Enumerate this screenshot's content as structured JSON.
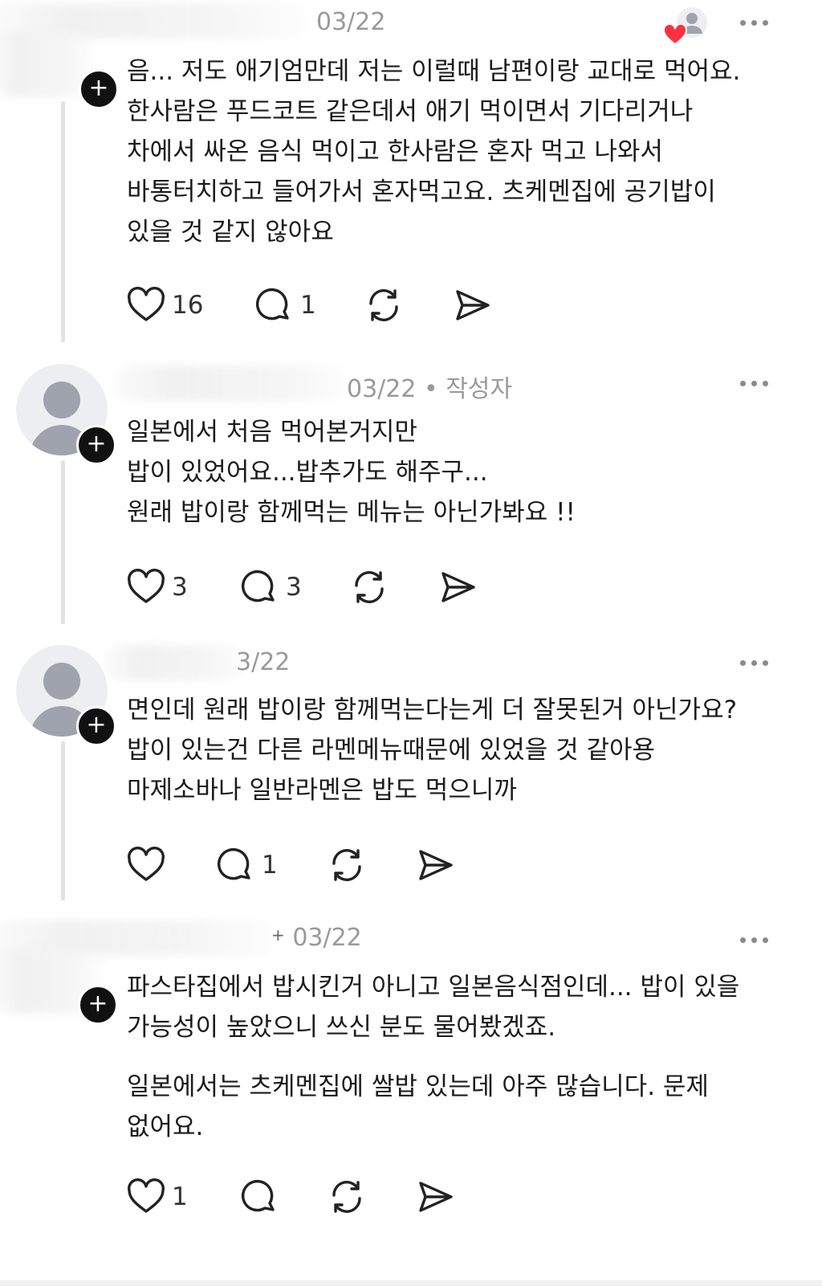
{
  "comments": [
    {
      "date": "03/22",
      "author_tag": "",
      "lines": [
        "음... 저도 애기엄만데 저는 이럴때 남편이랑 교대로 먹어요.",
        "한사람은 푸드코트 같은데서 애기 먹이면서 기다리거나",
        "차에서 싸온 음식 먹이고 한사람은 혼자 먹고 나와서",
        "바통터치하고 들어가서 혼자먹고요. 츠케멘집에 공기밥이",
        "있을 것 같지 않아요"
      ],
      "likes": "16",
      "replies": "1"
    },
    {
      "date": "03/22",
      "author_tag": "• 작성자",
      "lines": [
        "일본에서 처음 먹어본거지만",
        "밥이 있었어요...밥추가도 해주구...",
        "원래 밥이랑 함께먹는 메뉴는 아닌가봐요 !!"
      ],
      "likes": "3",
      "replies": "3"
    },
    {
      "date": "3/22",
      "author_tag": "",
      "lines": [
        "면인데 원래 밥이랑 함께먹는다는게 더 잘못된거 아닌가요?",
        "밥이 있는건 다른 라멘메뉴때문에 있었을 것 같아용",
        "마제소바나 일반라멘은 밥도 먹으니까"
      ],
      "likes": "",
      "replies": "1"
    },
    {
      "date": "03/22",
      "author_tag": "",
      "lines": [
        "파스타집에서 밥시킨거 아니고 일본음식점인데... 밥이 있을",
        "가능성이 높았으니 쓰신 분도 물어봤겠죠."
      ],
      "lines2": [
        "일본에서는 츠케멘집에 쌀밥 있는데 아주 많습니다. 문제",
        "없어요."
      ],
      "likes": "1",
      "replies": ""
    }
  ],
  "icons": {
    "like": "heart-icon",
    "reply": "comment-bubble-icon",
    "repost": "repost-icon",
    "share": "send-icon",
    "more": "more-dots-icon",
    "follow": "plus-icon",
    "liked_by_author": "heart-badge-icon"
  },
  "colors": {
    "text": "#1b1b1b",
    "meta": "#9a9a9a",
    "badge_heart": "#ff3040"
  }
}
